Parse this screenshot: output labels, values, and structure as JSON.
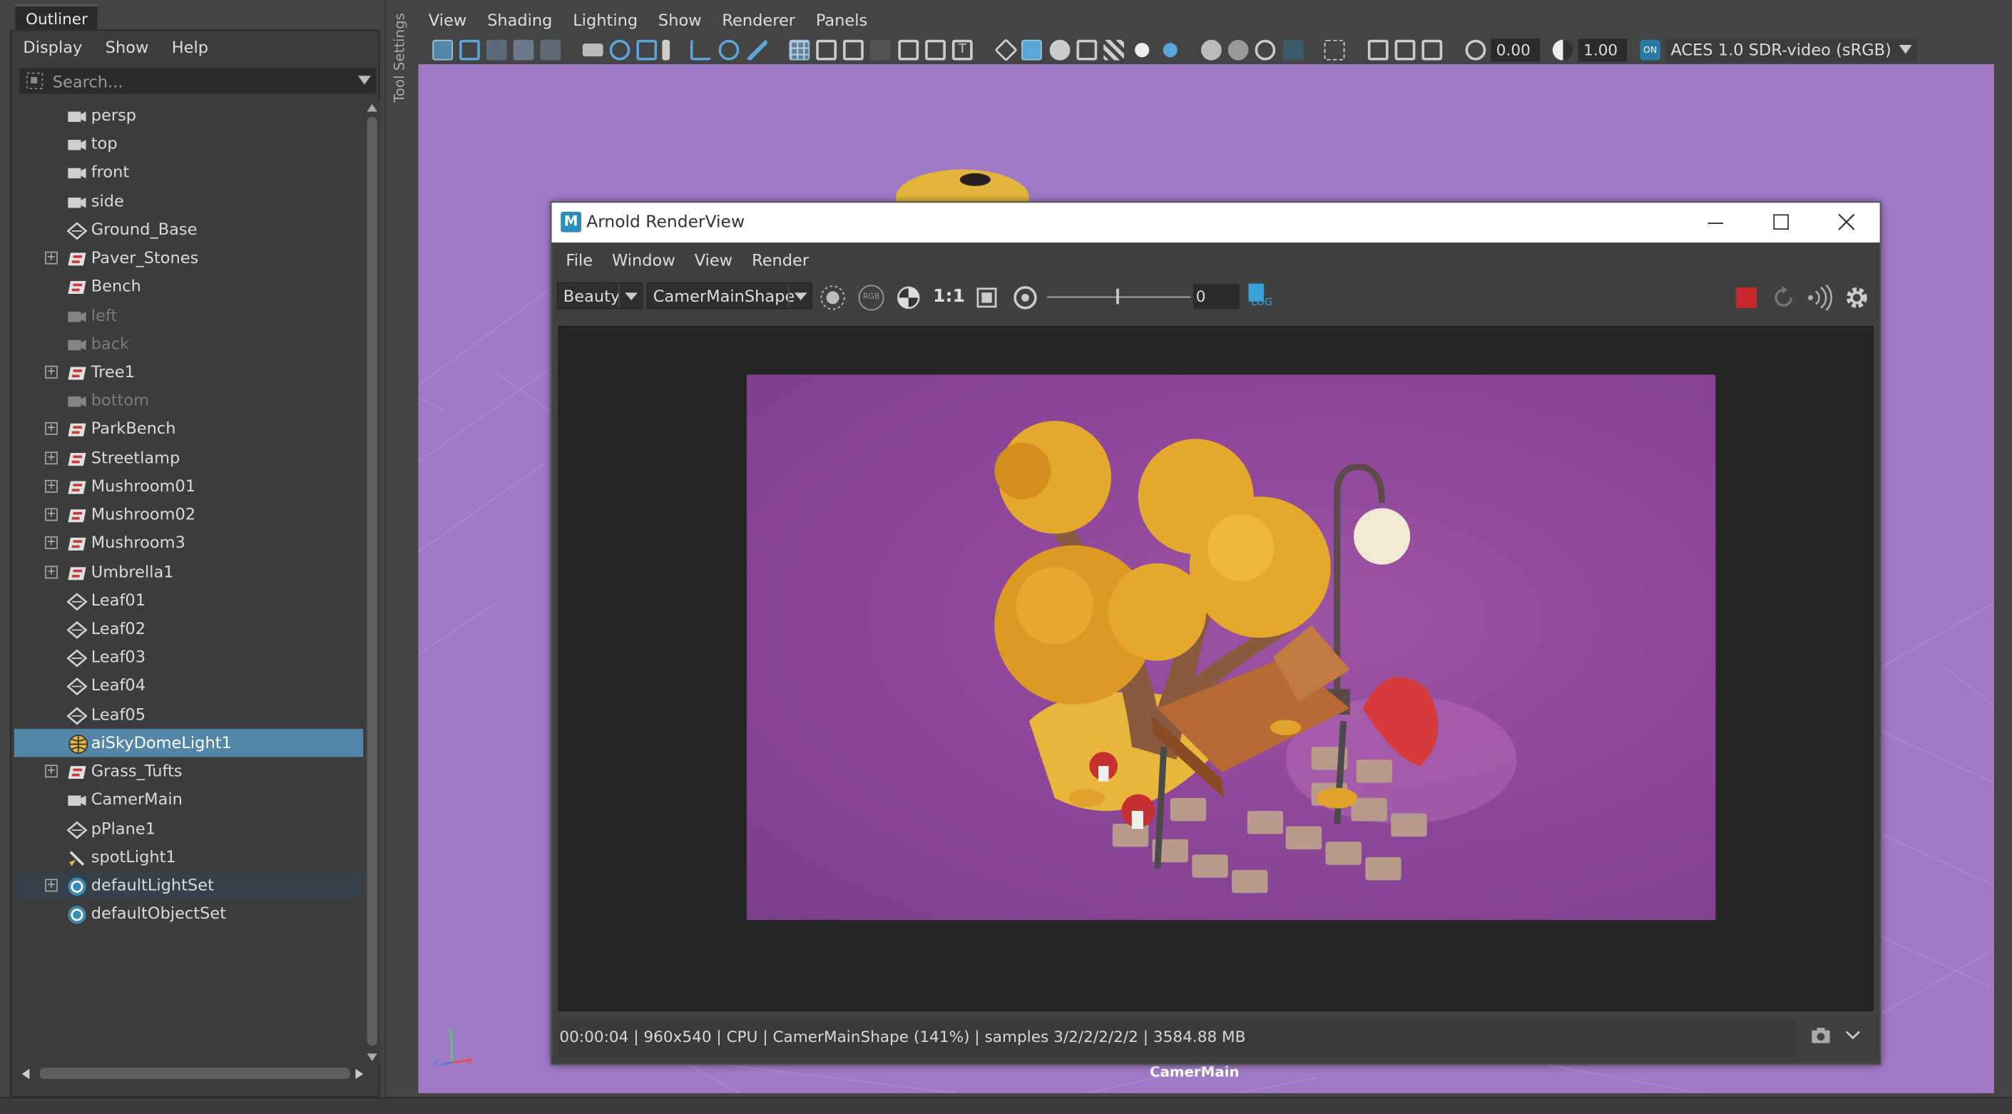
{
  "outliner": {
    "tab": "Outliner",
    "menu": [
      "Display",
      "Show",
      "Help"
    ],
    "search_placeholder": "Search...",
    "items": [
      {
        "label": "persp",
        "icon": "camera-icon",
        "expand": false,
        "state": ""
      },
      {
        "label": "top",
        "icon": "camera-icon",
        "expand": false,
        "state": ""
      },
      {
        "label": "front",
        "icon": "camera-icon",
        "expand": false,
        "state": ""
      },
      {
        "label": "side",
        "icon": "camera-icon",
        "expand": false,
        "state": ""
      },
      {
        "label": "Ground_Base",
        "icon": "mesh-icon",
        "expand": false,
        "state": ""
      },
      {
        "label": "Paver_Stones",
        "icon": "group-icon",
        "expand": true,
        "state": ""
      },
      {
        "label": "Bench",
        "icon": "group-icon",
        "expand": false,
        "state": ""
      },
      {
        "label": "left",
        "icon": "camera-icon",
        "expand": false,
        "state": "dim"
      },
      {
        "label": "back",
        "icon": "camera-icon",
        "expand": false,
        "state": "dim"
      },
      {
        "label": "Tree1",
        "icon": "group-icon",
        "expand": true,
        "state": ""
      },
      {
        "label": "bottom",
        "icon": "camera-icon",
        "expand": false,
        "state": "dim"
      },
      {
        "label": "ParkBench",
        "icon": "group-icon",
        "expand": true,
        "state": ""
      },
      {
        "label": "Streetlamp",
        "icon": "group-icon",
        "expand": true,
        "state": ""
      },
      {
        "label": "Mushroom01",
        "icon": "group-icon",
        "expand": true,
        "state": ""
      },
      {
        "label": "Mushroom02",
        "icon": "group-icon",
        "expand": true,
        "state": ""
      },
      {
        "label": "Mushroom3",
        "icon": "group-icon",
        "expand": true,
        "state": ""
      },
      {
        "label": "Umbrella1",
        "icon": "group-icon",
        "expand": true,
        "state": ""
      },
      {
        "label": "Leaf01",
        "icon": "mesh-icon",
        "expand": false,
        "state": ""
      },
      {
        "label": "Leaf02",
        "icon": "mesh-icon",
        "expand": false,
        "state": ""
      },
      {
        "label": "Leaf03",
        "icon": "mesh-icon",
        "expand": false,
        "state": ""
      },
      {
        "label": "Leaf04",
        "icon": "mesh-icon",
        "expand": false,
        "state": ""
      },
      {
        "label": "Leaf05",
        "icon": "mesh-icon",
        "expand": false,
        "state": ""
      },
      {
        "label": "aiSkyDomeLight1",
        "icon": "skydome-icon",
        "expand": false,
        "state": "sel"
      },
      {
        "label": "Grass_Tufts",
        "icon": "group-icon",
        "expand": true,
        "state": ""
      },
      {
        "label": "CamerMain",
        "icon": "camera-icon",
        "expand": false,
        "state": ""
      },
      {
        "label": "pPlane1",
        "icon": "mesh-icon",
        "expand": false,
        "state": ""
      },
      {
        "label": "spotLight1",
        "icon": "spotlight-icon",
        "expand": false,
        "state": ""
      },
      {
        "label": "defaultLightSet",
        "icon": "set-icon",
        "expand": true,
        "state": "hl"
      },
      {
        "label": "defaultObjectSet",
        "icon": "set-icon",
        "expand": false,
        "state": ""
      }
    ]
  },
  "tool_settings_label": "Tool Settings",
  "viewport": {
    "menu": [
      "View",
      "Shading",
      "Lighting",
      "Show",
      "Renderer",
      "Panels"
    ],
    "exposure": "0.00",
    "gamma": "1.00",
    "colorspace": "ACES 1.0 SDR-video (sRGB)",
    "camera_label": "CamerMain",
    "background": "#a07ac7"
  },
  "renderview": {
    "title": "Arnold RenderView",
    "menu": [
      "File",
      "Window",
      "View",
      "Render"
    ],
    "aov": "Beauty",
    "camera": "CamerMainShape",
    "ratio": "1:1",
    "rgb_label": "RGB",
    "log_label": "LOG",
    "slider_value": "0",
    "status": "00:00:04 | 960x540 | CPU | CamerMainShape (141%) | samples 3/2/2/2/2/2 | 3584.88 MB"
  }
}
